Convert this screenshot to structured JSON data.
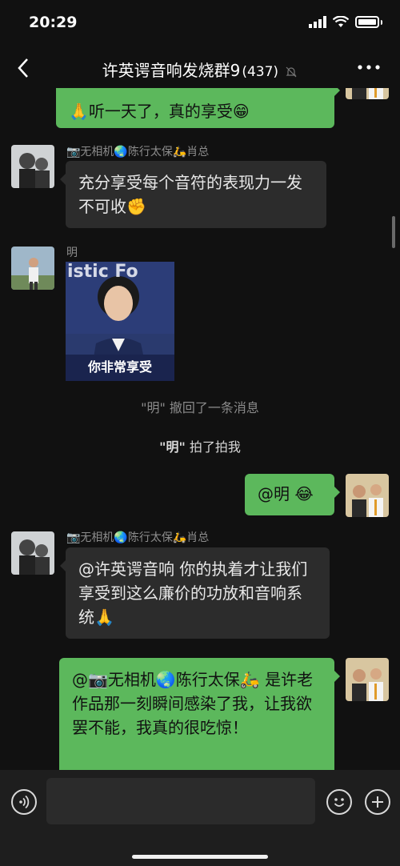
{
  "status_bar": {
    "time": "20:29"
  },
  "header": {
    "title": "许英谔音响发烧群9",
    "member_count": "(437)"
  },
  "messages": {
    "m1_top": {
      "text_line2": "🙏听一天了，真的享受😁"
    },
    "m2": {
      "sender": "📷无相机🌏陈行太保🛵肖总",
      "text": "充分享受每个音符的表现力一发不可收✊"
    },
    "m3": {
      "sender": "明",
      "sticker_caption": "你非常享受",
      "sticker_bg_text": "istic Fo"
    },
    "system1": {
      "name": "\"明\"",
      "text": " 撤回了一条消息"
    },
    "system2": {
      "name": "\"明\"",
      "text": " 拍了拍我"
    },
    "m4": {
      "text": "@明 😂"
    },
    "m5": {
      "sender": "📷无相机🌏陈行太保🛵肖总",
      "text": "@许英谔音响 你的执着才让我们享受到这么廉价的功放和音响系统🙏"
    },
    "m6": {
      "text": "@📷无相机🌏陈行太保🛵 是许老作品那一刻瞬间感染了我，让我欲罢不能，我真的很吃惊！"
    }
  },
  "colors": {
    "bubble_out": "#5cb85c",
    "bubble_in": "#2c2c2c",
    "background": "#111111"
  }
}
